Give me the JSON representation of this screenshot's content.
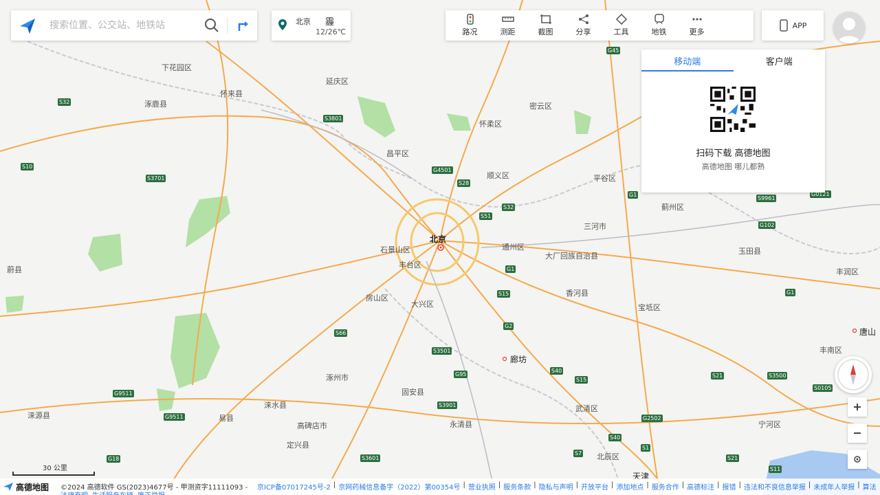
{
  "search": {
    "placeholder": "搜索位置、公交站、地铁站"
  },
  "weather": {
    "city": "北京",
    "condition": "霾",
    "temp": "12/26℃"
  },
  "toolbar": [
    {
      "label": "路况",
      "icon": "traffic-icon"
    },
    {
      "label": "测距",
      "icon": "ruler-icon"
    },
    {
      "label": "截图",
      "icon": "screenshot-icon"
    },
    {
      "label": "分享",
      "icon": "share-icon"
    },
    {
      "label": "工具",
      "icon": "tools-icon"
    },
    {
      "label": "地铁",
      "icon": "subway-icon"
    },
    {
      "label": "更多",
      "icon": "more-icon"
    }
  ],
  "app": {
    "label": "APP"
  },
  "qr": {
    "tabs": [
      "移动端",
      "客户端"
    ],
    "title": "扫码下载 高德地图",
    "subtitle": "高德地图 哪儿都熟"
  },
  "map_labels": {
    "places": [
      "下花园区",
      "怀来县",
      "延庆区",
      "涿鹿县",
      "密云区",
      "怀柔区",
      "昌平区",
      "顺义区",
      "平谷区",
      "蓟州区",
      "三河市",
      "玉田县",
      "丰润区",
      "北京",
      "石景山区",
      "通州区",
      "丰台区",
      "大厂回族自治县",
      "香河县",
      "宝坻区",
      "蔚县",
      "房山区",
      "大兴区",
      "涿州市",
      "固安县",
      "廊坊",
      "唐山",
      "丰南区",
      "涞源县",
      "易县",
      "涞水县",
      "高碑店市",
      "定兴县",
      "永清县",
      "武清区",
      "北辰区",
      "宁河区",
      "天津"
    ],
    "roads": [
      "S32",
      "S3801",
      "G45",
      "S10",
      "S3701",
      "G4501",
      "S28",
      "S32",
      "S51",
      "G1",
      "S15",
      "G2",
      "S66",
      "S3501",
      "G95",
      "S40",
      "S15",
      "G9511",
      "S3901",
      "G18",
      "S3601",
      "S40",
      "S7",
      "S1",
      "S21",
      "S3500",
      "S0105",
      "S21",
      "G2502",
      "G9511",
      "S11",
      "G1",
      "G102",
      "S9961",
      "G0121",
      "G1"
    ]
  },
  "scale": {
    "label": "30 公里"
  },
  "footer": {
    "brand": "高德地图",
    "copyright": "©2024 高德软件 GS(2023)4677号 - 甲测资字11111093 -",
    "links": [
      "京ICP备07017245号-2",
      "京网药械信息备字（2022）第00354号",
      "营业执照",
      "服务条款",
      "隐私与声明",
      "开放平台",
      "添加地点",
      "服务合作",
      "高德标注",
      "报错",
      "违法和不良信息举报",
      "未成年人举报",
      "算法"
    ],
    "row2": [
      "法律声明",
      "生活服务车辆",
      "廉正举报"
    ]
  }
}
